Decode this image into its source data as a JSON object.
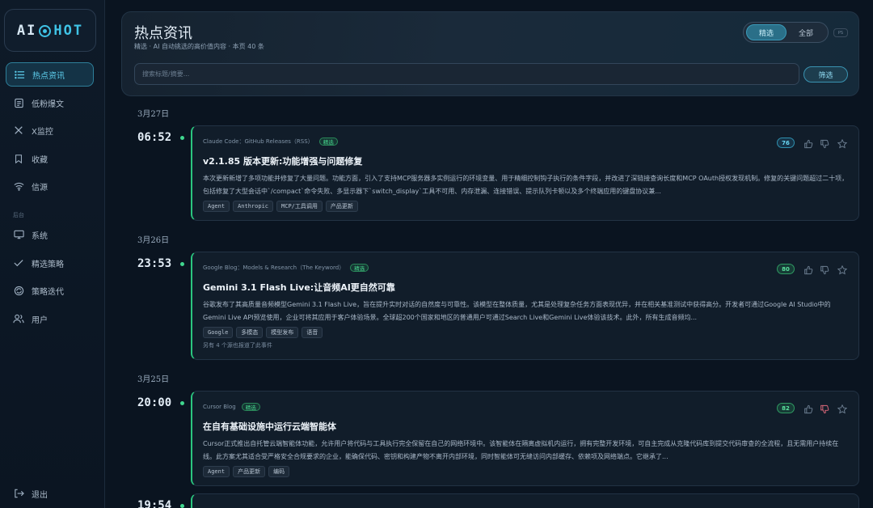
{
  "logo": {
    "left": "AI",
    "right": "HOT"
  },
  "sidebar": {
    "items": [
      {
        "label": "热点资讯",
        "icon": "list-icon"
      },
      {
        "label": "低粉爆文",
        "icon": "document-icon"
      },
      {
        "label": "X监控",
        "icon": "x-logo-icon"
      },
      {
        "label": "收藏",
        "icon": "bookmark-icon"
      },
      {
        "label": "信源",
        "icon": "wifi-icon"
      }
    ],
    "group_label": "后台",
    "admin_items": [
      {
        "label": "系统",
        "icon": "monitor-icon"
      },
      {
        "label": "精选策略",
        "icon": "check-icon"
      },
      {
        "label": "策略迭代",
        "icon": "cycle-icon"
      },
      {
        "label": "用户",
        "icon": "users-icon"
      }
    ],
    "logout": {
      "label": "退出",
      "icon": "logout-icon"
    }
  },
  "header": {
    "title": "热点资讯",
    "subtitle": "精选 · AI 自动挑选的高价值内容 · 本页 40 条",
    "toggle": {
      "selected": "精选",
      "other": "全部"
    },
    "shortcut": "PS",
    "search_placeholder": "搜索标题/摘要...",
    "filter_label": "筛选"
  },
  "feed": [
    {
      "date": "3月27日",
      "time": "06:52",
      "source": "Claude Code：GitHub Releases（RSS）",
      "badge": "精选",
      "title": "v2.1.85 版本更新:功能增强与问题修复",
      "summary": "本次更新新增了多项功能并修复了大量问题。功能方面，引入了支持MCP服务器多实例运行的环境变量、用于精细控制钩子执行的条件字段，并改进了深链接查询长度和MCP OAuth授权发现机制。修复的关键问题超过二十项，包括修复了大型会话中`/compact`命令失败、多显示器下`switch_display`工具不可用、内存泄漏、连接错误、提示队列卡顿以及多个终端应用的键盘协议兼...",
      "tags": [
        "Agent",
        "Anthropic",
        "MCP/工具调用",
        "产品更新"
      ],
      "extra": "",
      "score": "76",
      "score_color": "blue",
      "disliked": false
    },
    {
      "date": "3月26日",
      "time": "23:53",
      "source": "Google Blog：Models & Research（The Keyword）",
      "badge": "精选",
      "title": "Gemini 3.1 Flash Live:让音频AI更自然可靠",
      "summary": "谷歌发布了其高质量音频模型Gemini 3.1 Flash Live，旨在提升实时对话的自然度与可靠性。该模型在整体质量，尤其是处理复杂任务方面表现优异，并在相关基准测试中获得高分。开发者可通过Google AI Studio中的Gemini Live API预览使用，企业可将其应用于客户体验场景。全球超200个国家和地区的普通用户可通过Search Live和Gemini Live体验该技术。此外，所有生成音频均...",
      "tags": [
        "Google",
        "多模态",
        "模型发布",
        "语音"
      ],
      "extra": "另有 4 个源也报道了此事件",
      "score": "80",
      "score_color": "green",
      "disliked": false
    },
    {
      "date": "3月25日",
      "time": "20:00",
      "source": "Cursor Blog",
      "badge": "精选",
      "title": "在自有基础设施中运行云端智能体",
      "summary": "Cursor正式推出自托管云端智能体功能，允许用户将代码与工具执行完全保留在自己的网络环境中。该智能体在隔离虚拟机内运行，拥有完整开发环境，可自主完成从克隆代码库到提交代码审查的全流程，且无需用户持续在线。此方案尤其适合受严格安全合规要求的企业，能确保代码、密钥和构建产物不离开内部环境，同时智能体可无缝访问内部缓存、依赖项及网络端点。它继承了...",
      "tags": [
        "Agent",
        "产品更新",
        "编码"
      ],
      "extra": "",
      "score": "82",
      "score_color": "green",
      "disliked": true
    },
    {
      "date": "",
      "time": "19:54",
      "source": "",
      "badge": "",
      "title": "",
      "summary": "",
      "tags": [],
      "extra": "",
      "score": "",
      "score_color": "blue",
      "disliked": false
    }
  ]
}
